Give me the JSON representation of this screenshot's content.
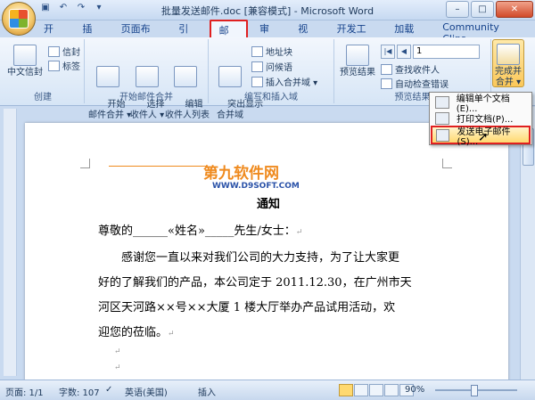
{
  "window": {
    "title": "批量发送邮件.doc [兼容模式] - Microsoft Word",
    "minimize": "–",
    "maximize": "□",
    "close": "✕"
  },
  "qat": {
    "save": "▣",
    "undo": "↶",
    "redo": "↷",
    "more": "▾"
  },
  "tabs": [
    "开始",
    "插入",
    "页面布局",
    "引用",
    "邮件",
    "审阅",
    "视图",
    "开发工具",
    "加载项",
    "Community Clips"
  ],
  "active_tab": "邮件",
  "ribbon": {
    "create": {
      "label": "创建",
      "chinese_envelope": "中文信封",
      "envelope": "信封",
      "labels": "标签"
    },
    "start_merge": {
      "label": "开始邮件合并",
      "start": "开始\n邮件合并 ▾",
      "select": "选择\n收件人 ▾",
      "edit": "编辑\n收件人列表"
    },
    "write_insert": {
      "label": "编写和插入域",
      "highlight": "突出显示\n合并域",
      "address_block": "地址块",
      "greeting": "问候语",
      "insert_field": "插入合并域 ▾"
    },
    "preview": {
      "label": "预览结果",
      "preview_btn": "预览结果",
      "record": "1",
      "find": "查找收件人",
      "auto_check": "自动检查错误"
    },
    "finish": {
      "label": "完成并\n合并 ▾"
    }
  },
  "dropdown": {
    "items": [
      "编辑单个文档(E)...",
      "打印文档(P)...",
      "发送电子邮件(S)..."
    ],
    "highlighted": 2
  },
  "document": {
    "watermark": "第九软件网",
    "watermark_url": "WWW.D9SOFT.COM",
    "heading": "通知",
    "greeting": "尊敬的______«姓名»_____先生/女士：",
    "para1": "感谢您一直以来对我们公司的大力支持，为了让大家更",
    "para2": "好的了解我们的产品，本公司定于 2011.12.30，在广州市天",
    "para3": "河区天河路××号××大厦 1 楼大厅举办产品试用活动，欢",
    "para4": "迎您的莅临。",
    "para_mark": "↵"
  },
  "status": {
    "page": "页面: 1/1",
    "words": "字数: 107",
    "lang": "英语(美国)",
    "mode": "插入",
    "zoom": "90%"
  }
}
